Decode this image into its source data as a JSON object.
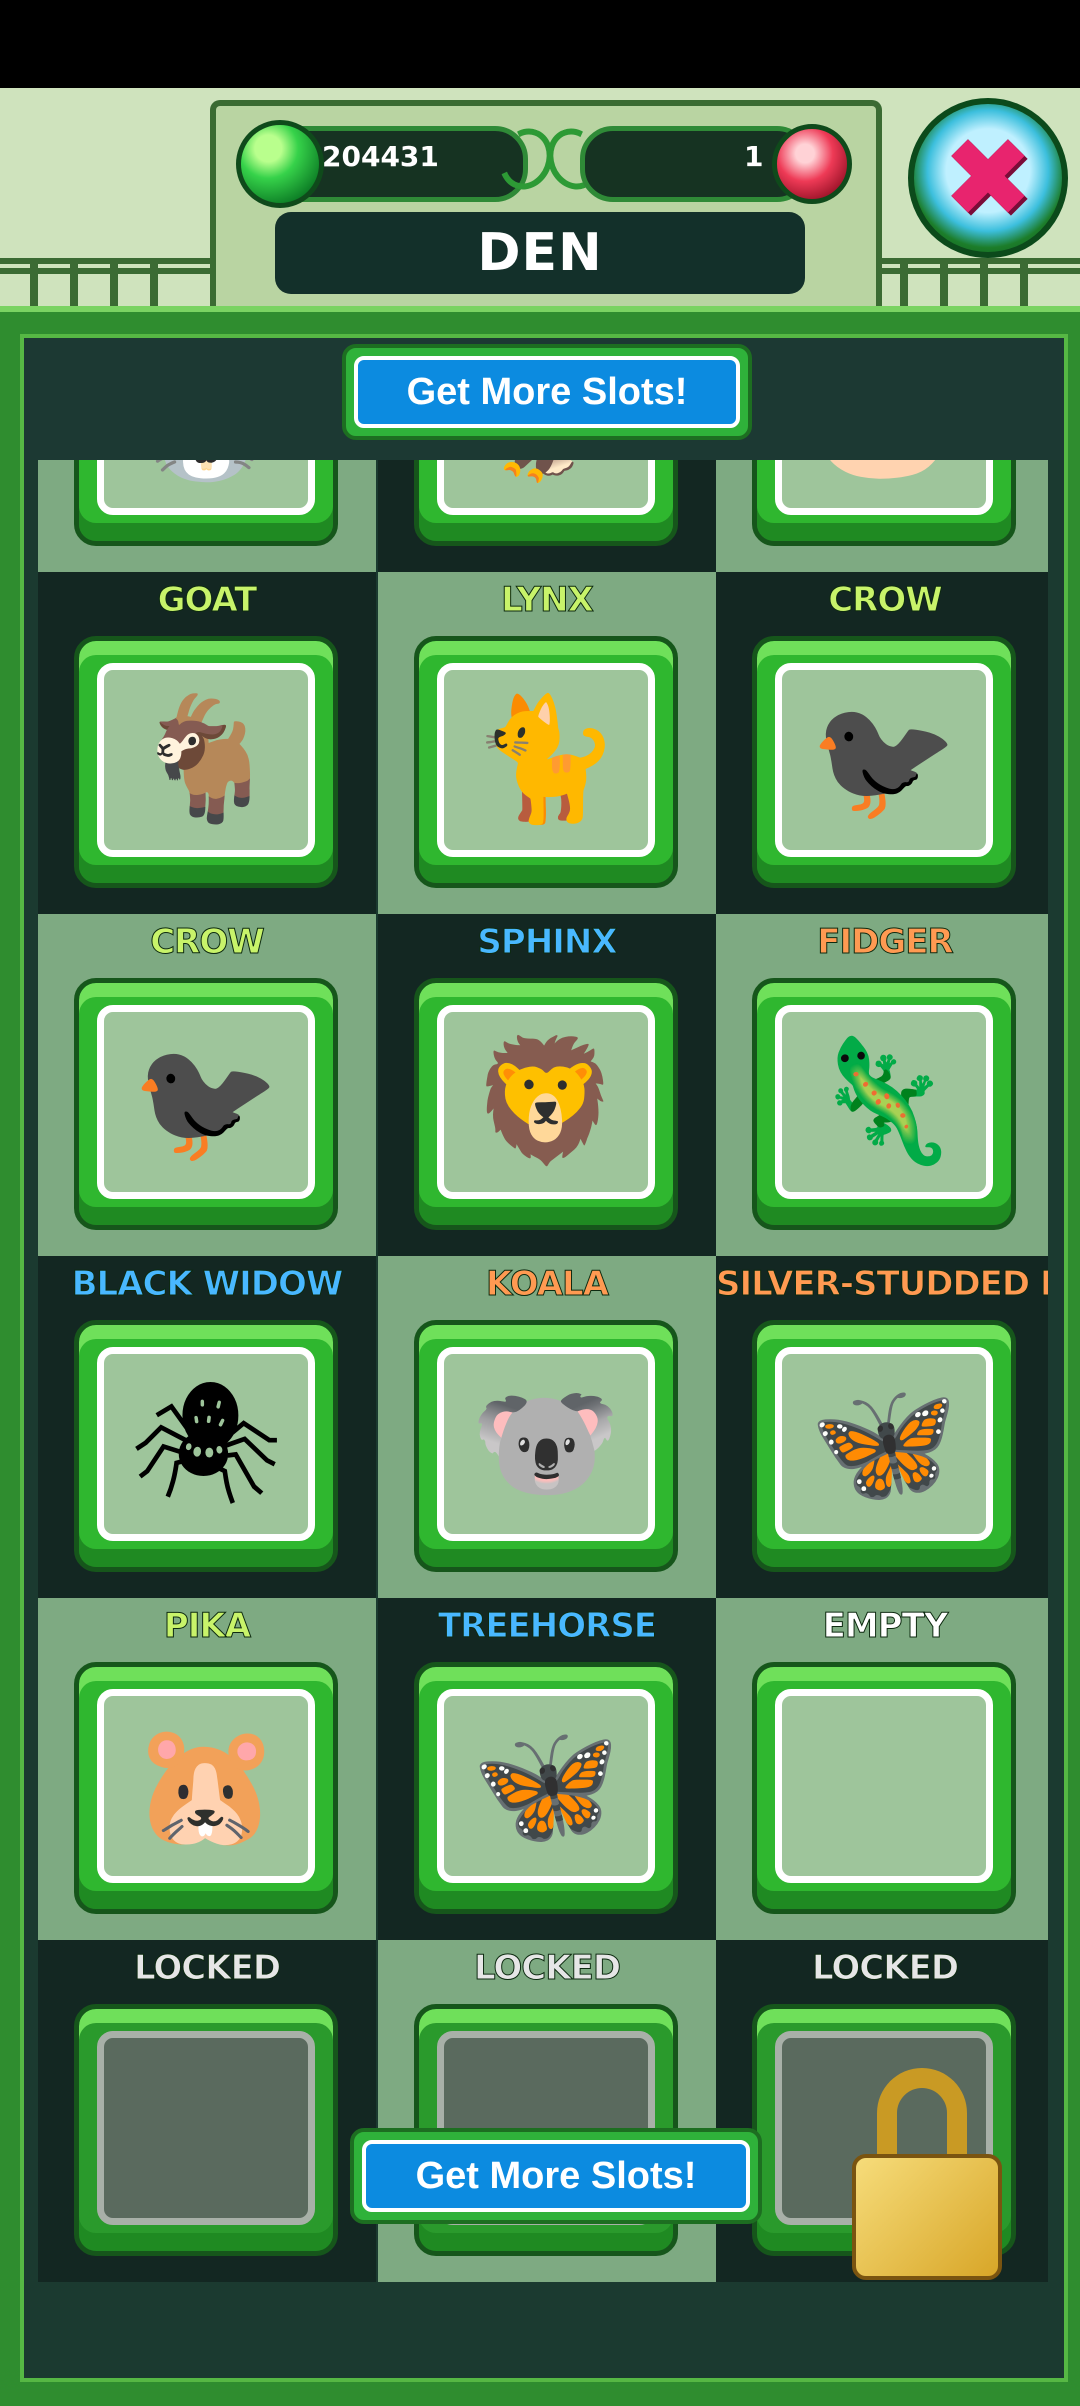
{
  "header": {
    "title": "DEN",
    "gems": "204431",
    "crystals": "1",
    "close_icon": "close-x-icon"
  },
  "top_button": {
    "label": "Get More Slots!"
  },
  "bottom_button": {
    "label": "Get More Slots!"
  },
  "slots": [
    {
      "name": "",
      "icon": "🐰",
      "state": "filled"
    },
    {
      "name": "",
      "icon": "🦅",
      "state": "filled"
    },
    {
      "name": "",
      "icon": "🐷",
      "state": "filled"
    },
    {
      "name": "GOAT",
      "color": "#c8f36a",
      "icon": "🐐",
      "state": "filled"
    },
    {
      "name": "LYNX",
      "color": "#c8f36a",
      "icon": "🐈",
      "state": "filled"
    },
    {
      "name": "CROW",
      "color": "#c8f36a",
      "icon": "🐦‍⬛",
      "state": "filled"
    },
    {
      "name": "CROW",
      "color": "#c8f36a",
      "icon": "🐦‍⬛",
      "state": "filled"
    },
    {
      "name": "SPHINX",
      "color": "#49b8ff",
      "icon": "🦁",
      "state": "filled"
    },
    {
      "name": "FIDGER",
      "color": "#ff9a52",
      "icon": "🦎",
      "state": "filled"
    },
    {
      "name": "BLACK WIDOW",
      "color": "#49b8ff",
      "icon": "🕷",
      "state": "filled"
    },
    {
      "name": "KOALA",
      "color": "#ff9a52",
      "icon": "🐨",
      "state": "filled"
    },
    {
      "name": "SILVER-STUDDED BLUI",
      "color": "#ff9a52",
      "icon": "🦋",
      "state": "filled"
    },
    {
      "name": "PIKA",
      "color": "#c8f36a",
      "icon": "🐹",
      "state": "filled"
    },
    {
      "name": "TREEHORSE",
      "color": "#49b8ff",
      "icon": "🦋",
      "state": "filled"
    },
    {
      "name": "EMPTY",
      "color": "#ffffff",
      "icon": "",
      "state": "empty"
    },
    {
      "name": "LOCKED",
      "color": "#e6e6e6",
      "icon": "",
      "state": "locked"
    },
    {
      "name": "LOCKED",
      "color": "#e6e6e6",
      "icon": "",
      "state": "locked"
    },
    {
      "name": "LOCKED",
      "color": "#e6e6e6",
      "icon": "",
      "state": "locked"
    }
  ]
}
